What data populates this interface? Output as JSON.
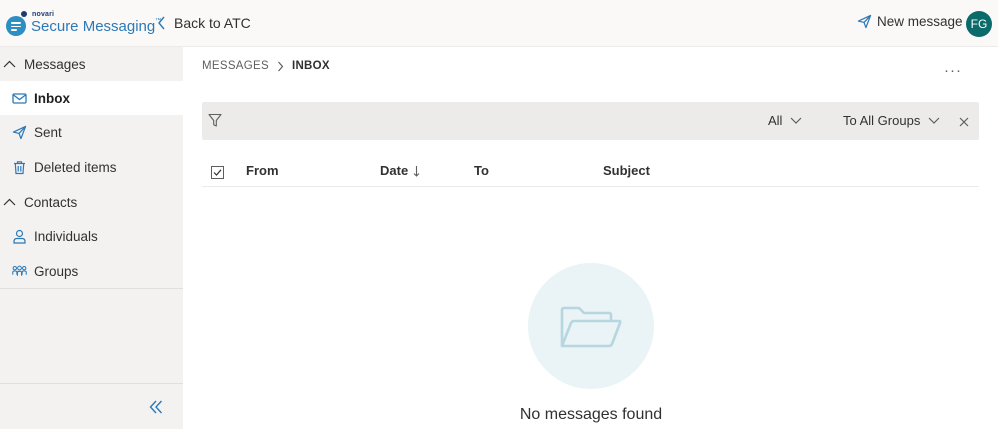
{
  "brand": {
    "small": "novari",
    "name": "Secure Messaging",
    "tm": "™"
  },
  "header": {
    "back_label": "Back to ATC",
    "new_message_label": "New message",
    "avatar_initials": "FG"
  },
  "sidebar": {
    "messages_section": "Messages",
    "contacts_section": "Contacts",
    "items": {
      "inbox": "Inbox",
      "sent": "Sent",
      "deleted": "Deleted items",
      "individuals": "Individuals",
      "groups": "Groups"
    },
    "active_item": "inbox"
  },
  "breadcrumb": {
    "root": "MESSAGES",
    "current": "INBOX"
  },
  "more_label": "···",
  "filter": {
    "status_value": "All",
    "group_value": "To All Groups"
  },
  "table": {
    "columns": [
      "From",
      "Date",
      "To",
      "Subject"
    ],
    "sort_column": "Date",
    "sort_direction": "desc"
  },
  "empty_state": {
    "message": "No messages found"
  },
  "colors": {
    "accent": "#2d79b6",
    "avatar": "#0b6a6a",
    "sidebar_bg": "#f3f2f1",
    "filter_bg": "#edebe9",
    "empty_circle": "#eaf3f5",
    "folder_icon": "#b6d6e0"
  },
  "icons": {
    "back": "chevron-left-icon",
    "new_message": "send-icon",
    "messages_section": "chevron-up-icon",
    "inbox": "mail-icon",
    "sent": "send-icon",
    "deleted": "trash-icon",
    "individuals": "person-icon",
    "groups": "people-group-icon",
    "collapse": "double-chevron-left-icon",
    "filter": "filter-icon",
    "close": "close-icon",
    "empty": "open-folder-icon"
  }
}
